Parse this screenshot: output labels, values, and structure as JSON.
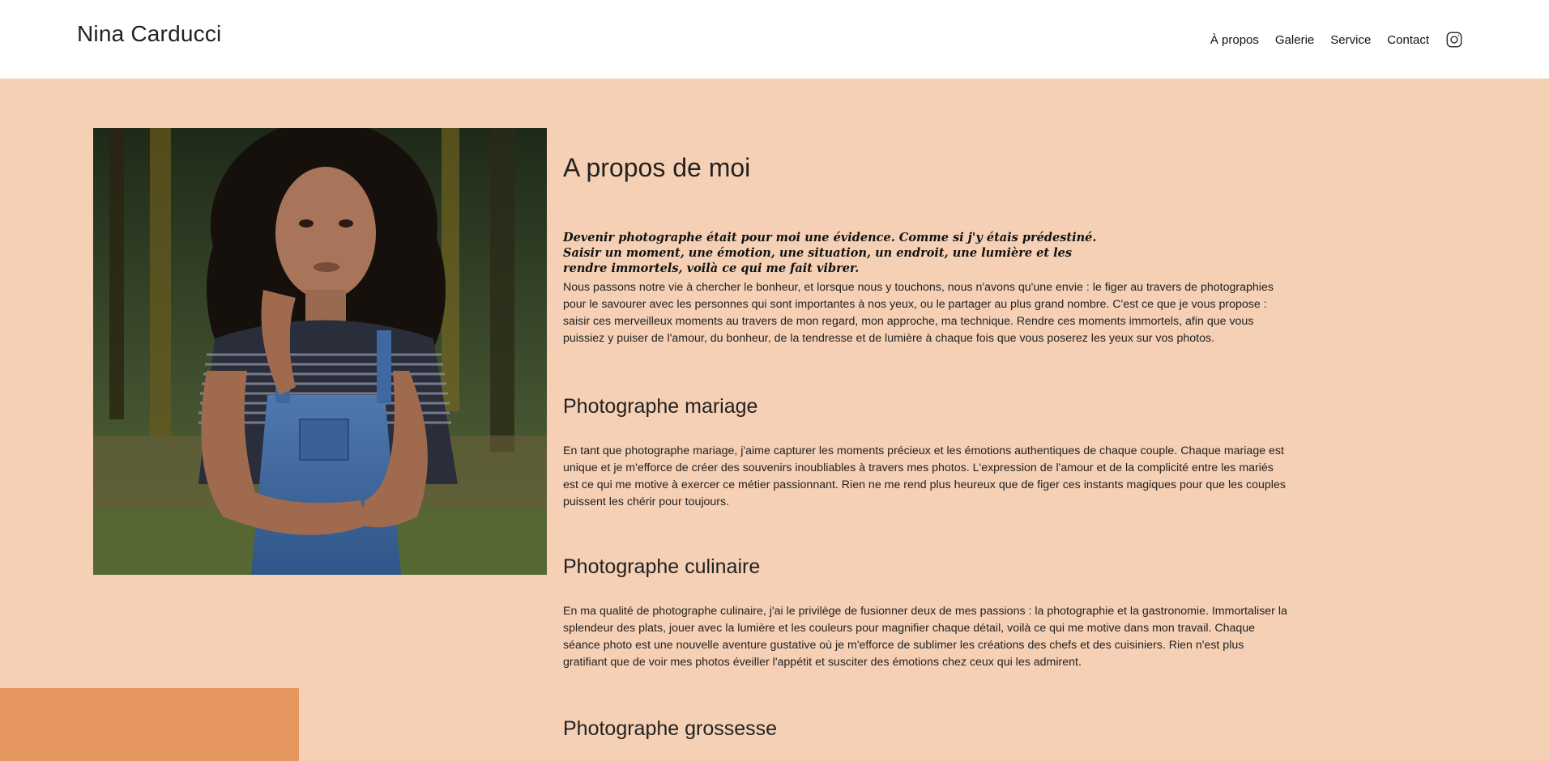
{
  "header": {
    "brand": "Nina Carducci",
    "nav": [
      "À propos",
      "Galerie",
      "Service",
      "Contact"
    ]
  },
  "about": {
    "title": "A propos de moi",
    "quote": "Devenir photographe était pour moi une évidence. Comme si j'y étais prédestiné. Saisir un moment, une émotion, une situation, un endroit, une lumière et les rendre immortels, voilà ce qui me fait vibrer.",
    "text": "Nous passons notre vie à chercher le bonheur, et lorsque nous y touchons, nous n'avons qu'une envie : le figer au travers de photographies pour le savourer avec les personnes qui sont importantes à nos yeux, ou le partager au plus grand nombre. C'est ce que je vous propose : saisir ces merveilleux moments au travers de mon regard, mon approche, ma technique. Rendre ces moments immortels, afin que vous puissiez y puiser de l'amour, du bonheur, de la tendresse et de lumière à chaque fois que vous poserez les yeux sur vos photos."
  },
  "sections": [
    {
      "title": "Photographe mariage",
      "text": "En tant que photographe mariage, j'aime capturer les moments précieux et les émotions authentiques de chaque couple. Chaque mariage est unique et je m'efforce de créer des souvenirs inoubliables à travers mes photos. L'expression de l'amour et de la complicité entre les mariés est ce qui me motive à exercer ce métier passionnant. Rien ne me rend plus heureux que de figer ces instants magiques pour que les couples puissent les chérir pour toujours."
    },
    {
      "title": "Photographe culinaire",
      "text": "En ma qualité de photographe culinaire, j'ai le privilège de fusionner deux de mes passions : la photographie et la gastronomie. Immortaliser la splendeur des plats, jouer avec la lumière et les couleurs pour magnifier chaque détail, voilà ce qui me motive dans mon travail. Chaque séance photo est une nouvelle aventure gustative où je m'efforce de sublimer les créations des chefs et des cuisiniers. Rien n'est plus gratifiant que de voir mes photos éveiller l'appétit et susciter des émotions chez ceux qui les admirent."
    },
    {
      "title": "Photographe grossesse"
    }
  ],
  "icons": {
    "social": "instagram-icon"
  },
  "colors": {
    "background": "#f5d0b5",
    "header": "#ffffff",
    "accent_block": "#e6975f"
  }
}
